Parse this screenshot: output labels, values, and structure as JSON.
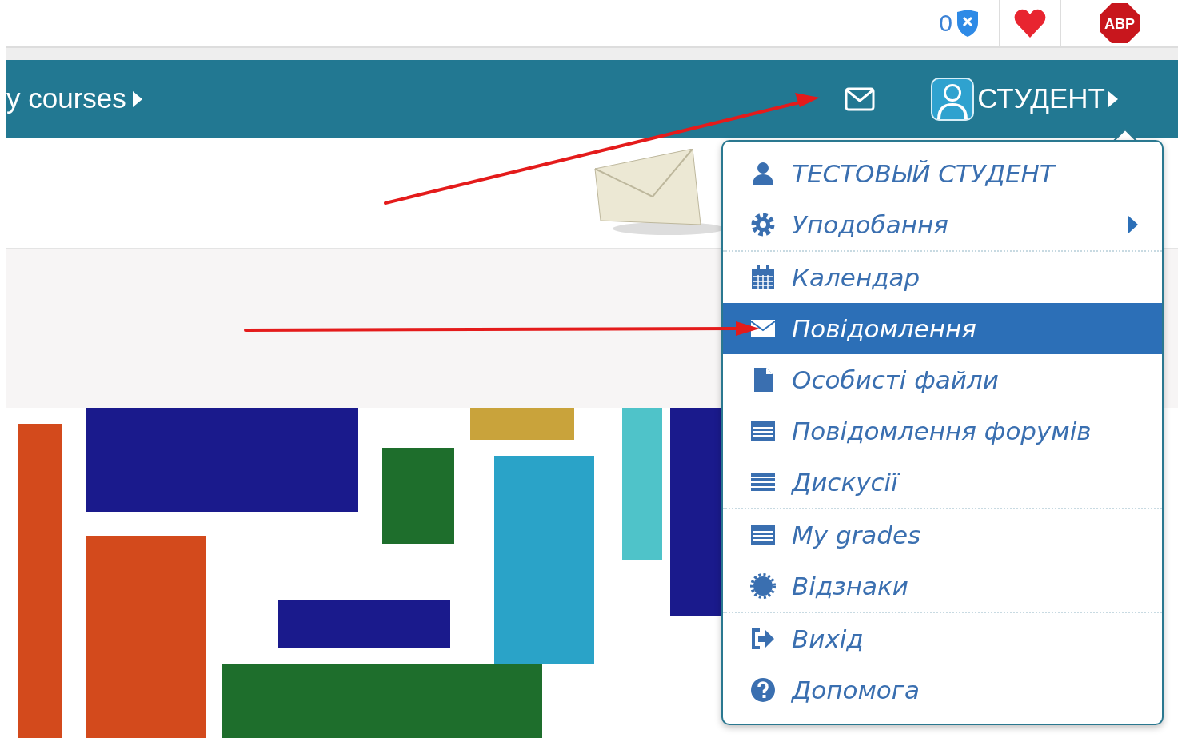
{
  "browser_toolbar": {
    "blocked_count": "0",
    "adblock_label": "ABP"
  },
  "navbar": {
    "courses_menu": "y courses",
    "user_menu": {
      "name": "СТУДЕНТ",
      "expanded": true
    }
  },
  "user_dropdown": {
    "items": [
      {
        "label": "ТЕСТОВЫЙ СТУДЕНТ",
        "kind": "user",
        "submenu": false,
        "selected": false,
        "divider_after": false
      },
      {
        "label": "Уподобання",
        "kind": "preferences",
        "submenu": true,
        "selected": false,
        "divider_after": true
      },
      {
        "label": "Календар",
        "kind": "calendar",
        "submenu": false,
        "selected": false,
        "divider_after": false
      },
      {
        "label": "Повідомлення",
        "kind": "messages",
        "submenu": false,
        "selected": true,
        "divider_after": false
      },
      {
        "label": "Особисті файли",
        "kind": "files",
        "submenu": false,
        "selected": false,
        "divider_after": false
      },
      {
        "label": "Повідомлення форумів",
        "kind": "forum",
        "submenu": false,
        "selected": false,
        "divider_after": false
      },
      {
        "label": "Дискусії",
        "kind": "discussions",
        "submenu": false,
        "selected": false,
        "divider_after": true
      },
      {
        "label": "My grades",
        "kind": "grades",
        "submenu": false,
        "selected": false,
        "divider_after": false
      },
      {
        "label": "Відзнаки",
        "kind": "badges",
        "submenu": false,
        "selected": false,
        "divider_after": true
      },
      {
        "label": "Вихід",
        "kind": "logout",
        "submenu": false,
        "selected": false,
        "divider_after": false
      },
      {
        "label": "Допомога",
        "kind": "help",
        "submenu": false,
        "selected": false,
        "divider_after": false
      }
    ]
  }
}
